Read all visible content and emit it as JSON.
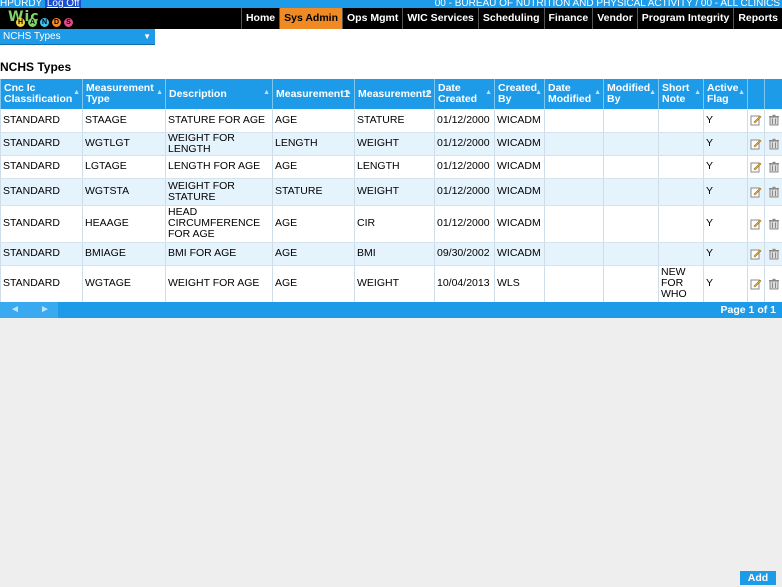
{
  "header": {
    "user": "HPURDY",
    "logoff": "Log Off",
    "agency": "00 - BUREAU OF NUTRITION AND PHYSICAL ACTIVITY / 00 - ALL CLINICS"
  },
  "logo": {
    "symbol": "Wic",
    "letters": [
      "H",
      "A",
      "N",
      "D",
      "S"
    ]
  },
  "nav": {
    "items": [
      "Home",
      "Sys Admin",
      "Ops Mgmt",
      "WIC Services",
      "Scheduling",
      "Finance",
      "Vendor",
      "Program Integrity",
      "Reports"
    ],
    "active": "Sys Admin"
  },
  "dropdown": {
    "selected": "NCHS Types"
  },
  "page_title": "NCHS Types",
  "table": {
    "columns": [
      "Cnc Ic Classification",
      "Measurement Type",
      "Description",
      "Measurement1",
      "Measurement2",
      "Date Created",
      "Created By",
      "Date Modified",
      "Modified By",
      "Short Note",
      "Active Flag"
    ],
    "rows": [
      [
        "STANDARD",
        "STAAGE",
        "STATURE FOR AGE",
        "AGE",
        "STATURE",
        "01/12/2000",
        "WICADM",
        "",
        "",
        "",
        "Y"
      ],
      [
        "STANDARD",
        "WGTLGT",
        "WEIGHT FOR LENGTH",
        "LENGTH",
        "WEIGHT",
        "01/12/2000",
        "WICADM",
        "",
        "",
        "",
        "Y"
      ],
      [
        "STANDARD",
        "LGTAGE",
        "LENGTH FOR AGE",
        "AGE",
        "LENGTH",
        "01/12/2000",
        "WICADM",
        "",
        "",
        "",
        "Y"
      ],
      [
        "STANDARD",
        "WGTSTA",
        "WEIGHT FOR STATURE",
        "STATURE",
        "WEIGHT",
        "01/12/2000",
        "WICADM",
        "",
        "",
        "",
        "Y"
      ],
      [
        "STANDARD",
        "HEAAGE",
        "HEAD CIRCUMFERENCE FOR AGE",
        "AGE",
        "CIR",
        "01/12/2000",
        "WICADM",
        "",
        "",
        "",
        "Y"
      ],
      [
        "STANDARD",
        "BMIAGE",
        "BMI FOR AGE",
        "AGE",
        "BMI",
        "09/30/2002",
        "WICADM",
        "",
        "",
        "",
        "Y"
      ],
      [
        "STANDARD",
        "WGTAGE",
        "WEIGHT FOR AGE",
        "AGE",
        "WEIGHT",
        "10/04/2013",
        "WLS",
        "",
        "",
        "NEW FOR WHO",
        "Y"
      ]
    ]
  },
  "pager": {
    "prev": "◄",
    "next": "►",
    "info": "Page 1 of 1"
  },
  "add_label": "Add",
  "colors": {
    "accent": "#1e9be8",
    "active_tab": "#f08a24",
    "row_alt": "#e5f3fc"
  }
}
